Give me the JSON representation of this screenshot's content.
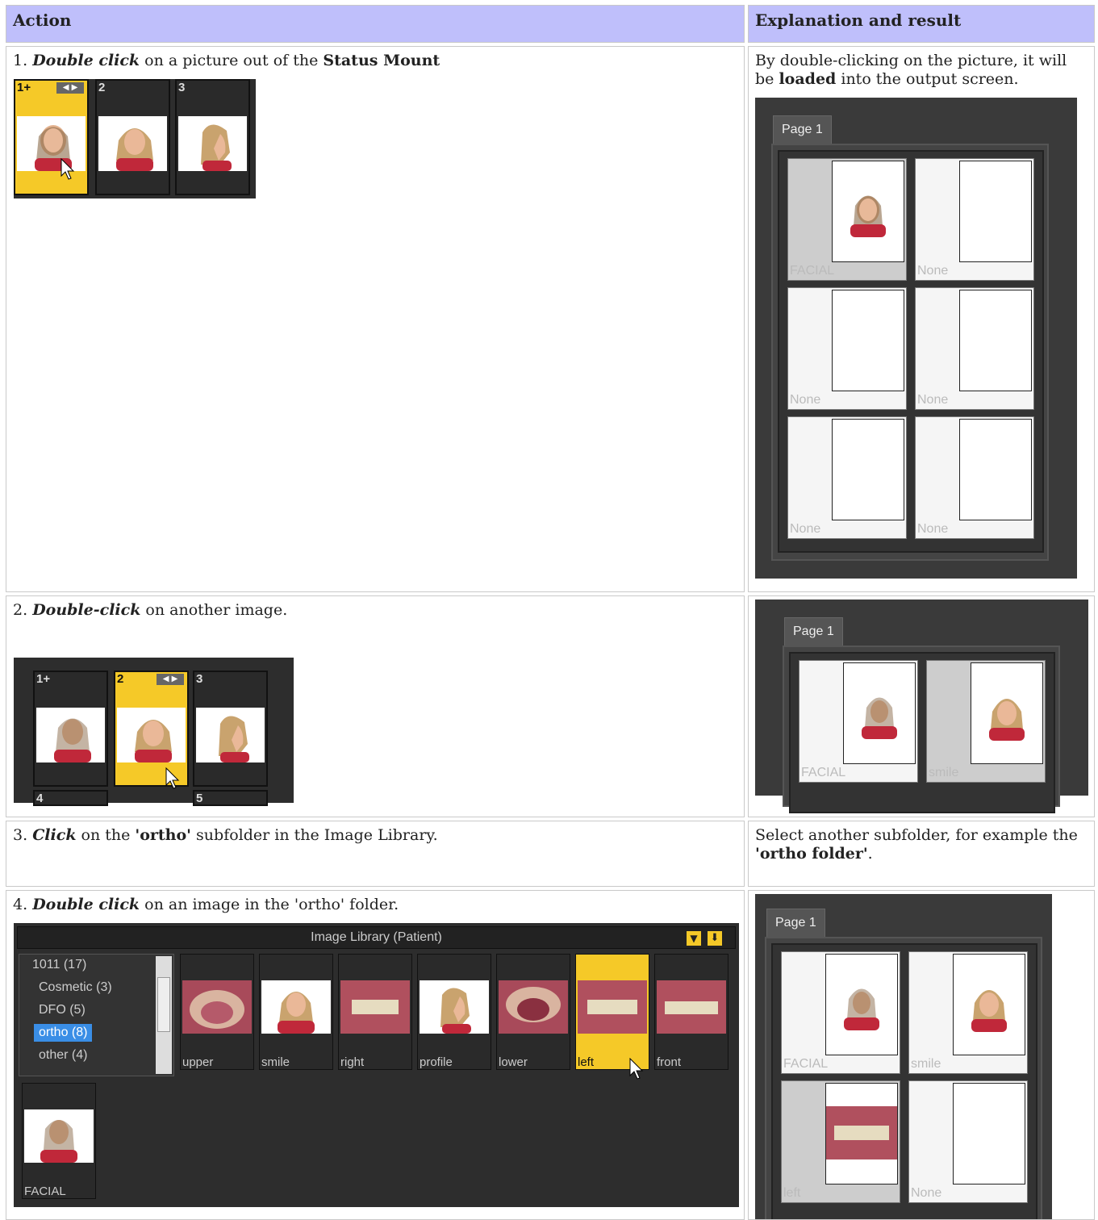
{
  "headers": {
    "action": "Action",
    "result": "Explanation and result"
  },
  "rows": [
    {
      "step": "1.",
      "verb": "Double click",
      "mid": " on a picture out of the ",
      "bold": "Status Mount",
      "result_pre": "By double-clicking on the picture, it will be ",
      "result_bold": "loaded",
      "result_post": " into the output screen."
    },
    {
      "step": "2.",
      "verb": "Double-click",
      "mid": " on another image."
    },
    {
      "step": "3.",
      "verb": "Click",
      "mid": " on the ",
      "bold": "'ortho'",
      "post": " subfolder in the Image Library.",
      "result_pre": "Select another subfolder, for example the ",
      "result_bold": "'ortho folder'",
      "result_post": "."
    },
    {
      "step": "4.",
      "verb": "Double click",
      "mid": " on an image in the 'ortho' folder."
    }
  ],
  "mount1": {
    "thumbs": [
      "1+",
      "2",
      "3"
    ]
  },
  "mount2": {
    "thumbs": [
      "1+",
      "2",
      "3",
      "4",
      "5"
    ]
  },
  "page_tab": "Page 1",
  "output1": {
    "slots": [
      "FACIAL",
      "None",
      "None",
      "None",
      "None",
      "None"
    ]
  },
  "output2": {
    "slots": [
      "FACIAL",
      "smile"
    ]
  },
  "output4": {
    "slots": [
      "FACIAL",
      "smile",
      "left",
      "None"
    ]
  },
  "library": {
    "title": "Image Library (Patient)",
    "tree": [
      "1011 (17)",
      "Cosmetic (3)",
      "DFO (5)",
      "ortho (8)",
      "other (4)"
    ],
    "thumbs": [
      "upper",
      "smile",
      "right",
      "profile",
      "lower",
      "left",
      "front",
      "FACIAL"
    ]
  },
  "colors": {
    "header_bg": "#bfbffb",
    "selected": "#f5c928",
    "tree_selected": "#3a8ee6"
  }
}
